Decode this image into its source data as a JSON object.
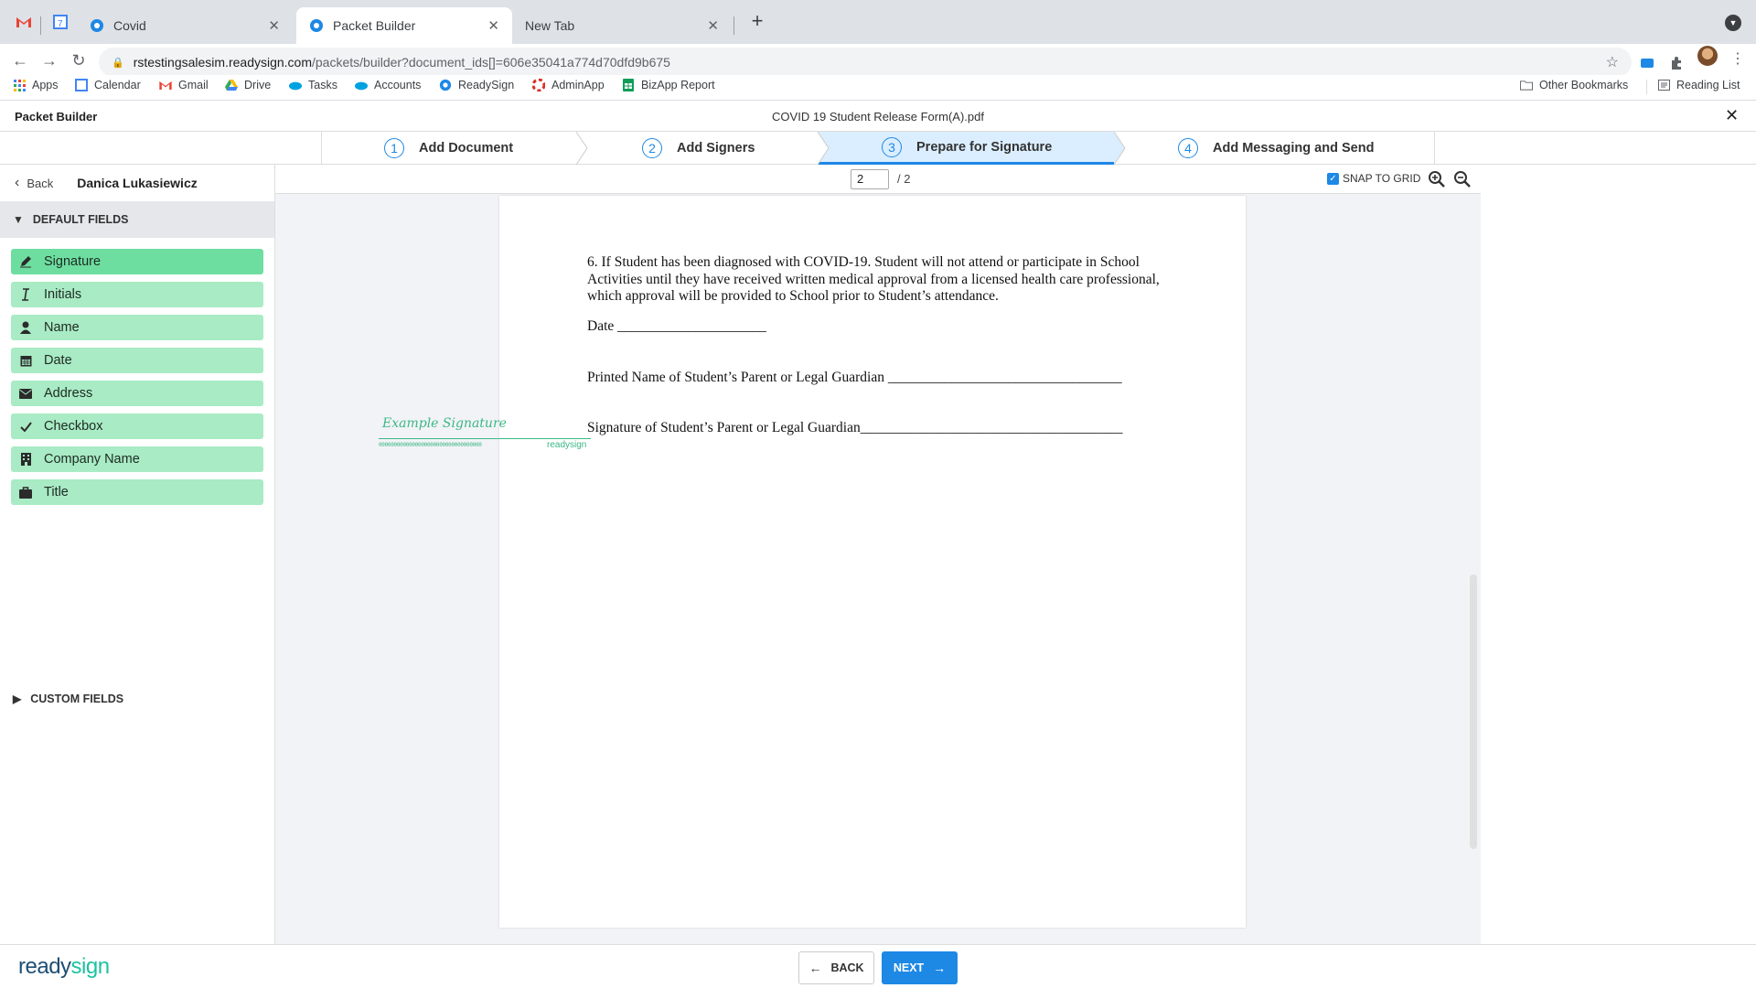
{
  "browser": {
    "tabs": [
      {
        "label": "Covid"
      },
      {
        "label": "Packet Builder"
      },
      {
        "label": "New Tab"
      }
    ],
    "url_host": "rstestingsalesim.readysign.com",
    "url_path": "/packets/builder?document_ids[]=606e35041a774d70dfd9b675",
    "bookmarks": [
      {
        "label": "Apps",
        "icon": "apps-grid-icon"
      },
      {
        "label": "Calendar",
        "icon": "calendar-icon"
      },
      {
        "label": "Gmail",
        "icon": "gmail-icon"
      },
      {
        "label": "Drive",
        "icon": "drive-icon"
      },
      {
        "label": "Tasks",
        "icon": "cloud-icon"
      },
      {
        "label": "Accounts",
        "icon": "cloud-icon"
      },
      {
        "label": "ReadySign",
        "icon": "readysign-icon"
      },
      {
        "label": "AdminApp",
        "icon": "lifebuoy-icon"
      },
      {
        "label": "BizApp Report",
        "icon": "sheets-icon"
      }
    ],
    "other_bookmarks": "Other Bookmarks",
    "reading_list": "Reading List"
  },
  "app": {
    "title": "Packet Builder",
    "document_title": "COVID 19 Student Release Form(A).pdf",
    "steps": [
      {
        "num": "1",
        "label": "Add Document"
      },
      {
        "num": "2",
        "label": "Add Signers"
      },
      {
        "num": "3",
        "label": "Prepare for Signature"
      },
      {
        "num": "4",
        "label": "Add Messaging and Send"
      }
    ]
  },
  "sidebar": {
    "back_label": "Back",
    "signer_name": "Danica Lukasiewicz",
    "default_fields_label": "DEFAULT FIELDS",
    "custom_fields_label": "CUSTOM FIELDS",
    "fields": [
      {
        "label": "Signature",
        "icon": "pen-icon"
      },
      {
        "label": "Initials",
        "icon": "initials-icon"
      },
      {
        "label": "Name",
        "icon": "person-icon"
      },
      {
        "label": "Date",
        "icon": "calendar-icon"
      },
      {
        "label": "Address",
        "icon": "envelope-icon"
      },
      {
        "label": "Checkbox",
        "icon": "check-icon"
      },
      {
        "label": "Company Name",
        "icon": "building-icon"
      },
      {
        "label": "Title",
        "icon": "briefcase-icon"
      }
    ]
  },
  "viewer": {
    "page_value": "2",
    "page_total": "/ 2",
    "snap_to_grid": "SNAP TO GRID",
    "paragraph": "6. If Student has been diagnosed with COVID-19. Student will not attend or participate in School Activities until they have received written medical approval from a licensed health care professional, which approval will be provided to School prior to Student’s attendance.",
    "date_line": "Date _____________________",
    "printed_name_line": "Printed Name of Student’s Parent or Legal Guardian _________________________________",
    "signature_line": "Signature of Student’s Parent or Legal Guardian_____________________________________",
    "sig_example": "Example Signature",
    "sig_code": "0000000000000000000000000000000000",
    "sig_brand": "readysign"
  },
  "footer": {
    "logo_main": "ready",
    "logo_accent": "sign",
    "back_button": "BACK",
    "next_button": "NEXT"
  },
  "colors": {
    "accent": "#1e88e5",
    "field_bg": "#a8ebc4",
    "field_selected": "#6ddea0"
  }
}
